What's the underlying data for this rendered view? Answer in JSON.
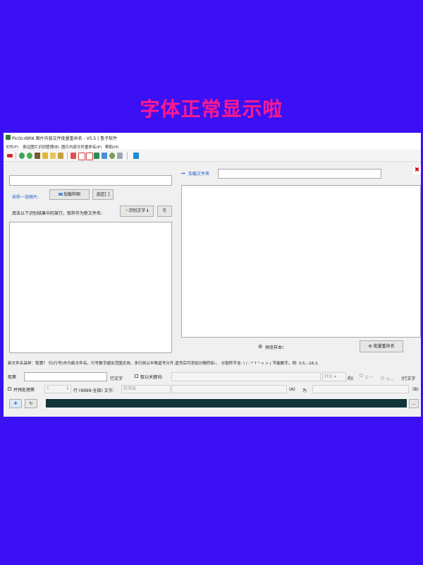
{
  "headline": "字体正常显示啦",
  "window": {
    "title": "PicOcrBRN  图片内容文件批量重命名 - V5.5   |  鲁子软件",
    "menu": [
      "文件(F)",
      "身证图片识别管理(B)",
      "图片内容文件重命名(P)",
      "帮助(H)"
    ]
  },
  "left": {
    "sample_label": "采样一张图片:",
    "load_sample_button": "加载样图",
    "select_button": "选区[ ]",
    "instruction": "双击以下识别结果中的某行，取样作为新文件名:",
    "ocr_button": "识别文字"
  },
  "right": {
    "load_folder_label": "加载文件夹",
    "preview_button": "预览样本!",
    "batch_rename_button": "批量重命名"
  },
  "info_line": "新文件名采样：取第？ 行(行号)作为新文件名。行号数字超出范围无效。多行则以半角逗号分开,逗号后可添加分隔符如-。  分割符不含: \\ / : * ? \" < > | 不能数字。例:  3,5,-,16,1.",
  "rule_row": {
    "take_label": "取第",
    "line_text_label": "行文字",
    "keyword_label": "取以关键词:",
    "start_select": "开头",
    "of_label": "的(",
    "prev_label": "上一",
    "next_label": "下一",
    "end_label": ")行文字"
  },
  "batch_row": {
    "combine_label": "并预处理第",
    "stepper_value": "1",
    "line_label": "行 (9999:全部) 文字:",
    "action_select": "前添加",
    "a_label": "(A)",
    "as_label": "为",
    "b_label": "(B)"
  },
  "colors": {
    "background": "#3b10f5",
    "headline": "#ff1a8c",
    "progress_bar": "#103438"
  }
}
